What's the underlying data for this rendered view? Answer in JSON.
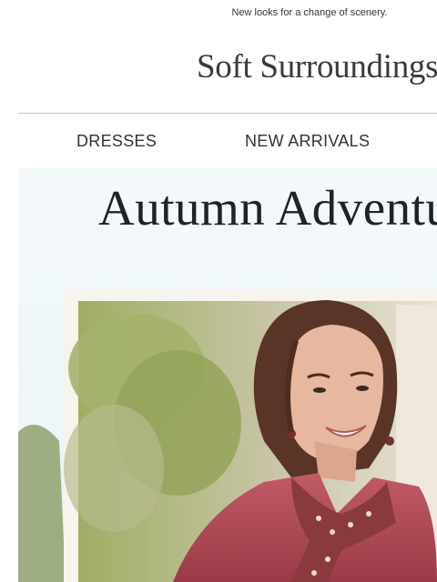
{
  "preheader": {
    "text": "New looks for a change of scenery."
  },
  "brand": {
    "name": "Soft Surroundings",
    "registered_mark": "®"
  },
  "nav": {
    "items": [
      {
        "label": "DRESSES"
      },
      {
        "label": "NEW ARRIVALS"
      }
    ]
  },
  "hero": {
    "title": "Autumn Adventu"
  },
  "colors": {
    "text": "#333333",
    "divider": "#c8c8c8",
    "hero_bg": "#f4f9fc",
    "jacket": "#b04a56"
  }
}
